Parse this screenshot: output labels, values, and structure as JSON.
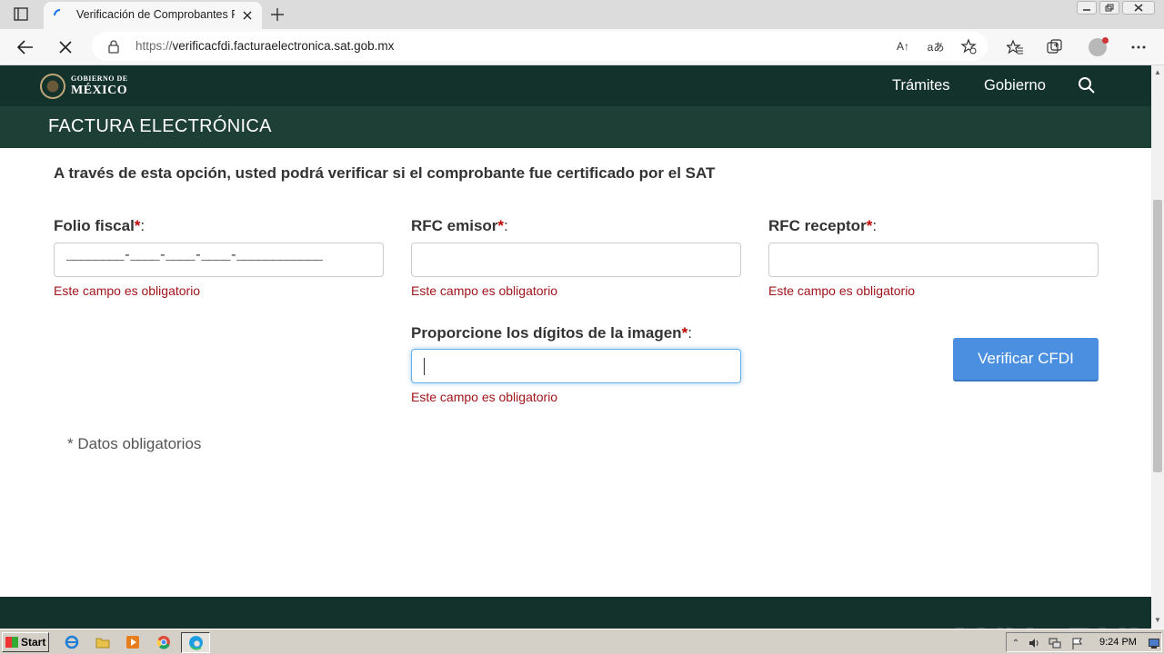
{
  "browser": {
    "tab_title": "Verificación de Comprobantes Fi",
    "url_host": "https://verificacfdi.facturaelectronica.sat.gob.mx",
    "url_display_prefix": "https://",
    "url_display_domain": "verificacfdi.facturaelectronica.sat.gob.mx",
    "read_aloud_label": "A↑",
    "translate_label": "aあ"
  },
  "header": {
    "logo_line1": "GOBIERNO DE",
    "logo_line2": "MÉXICO",
    "nav": [
      "Trámites",
      "Gobierno"
    ]
  },
  "subheader": {
    "title": "FACTURA ELECTRÓNICA"
  },
  "form": {
    "intro": "A través de esta opción, usted podrá verificar si el comprobante fue certificado por el SAT",
    "required_mark": "*",
    "colon": ":",
    "folio": {
      "label": "Folio fiscal",
      "mask": "________-____-____-____-____________",
      "error": "Este campo es obligatorio"
    },
    "rfc_emisor": {
      "label": "RFC emisor",
      "value": "",
      "error": "Este campo es obligatorio"
    },
    "rfc_receptor": {
      "label": "RFC receptor",
      "value": "",
      "error": "Este campo es obligatorio"
    },
    "captcha": {
      "label": "Proporcione los dígitos de la imagen",
      "value": "",
      "error": "Este campo es obligatorio"
    },
    "submit_label": "Verificar CFDI",
    "note": "* Datos obligatorios"
  },
  "watermark": "ANY▷RUN",
  "taskbar": {
    "start_label": "Start",
    "clock": "9:24 PM"
  },
  "colors": {
    "gov_green_dark": "#13322b",
    "gov_green": "#1e3f36",
    "required_red": "#c00000",
    "error_red": "#a0151b",
    "button_blue": "#4a8fe0"
  }
}
